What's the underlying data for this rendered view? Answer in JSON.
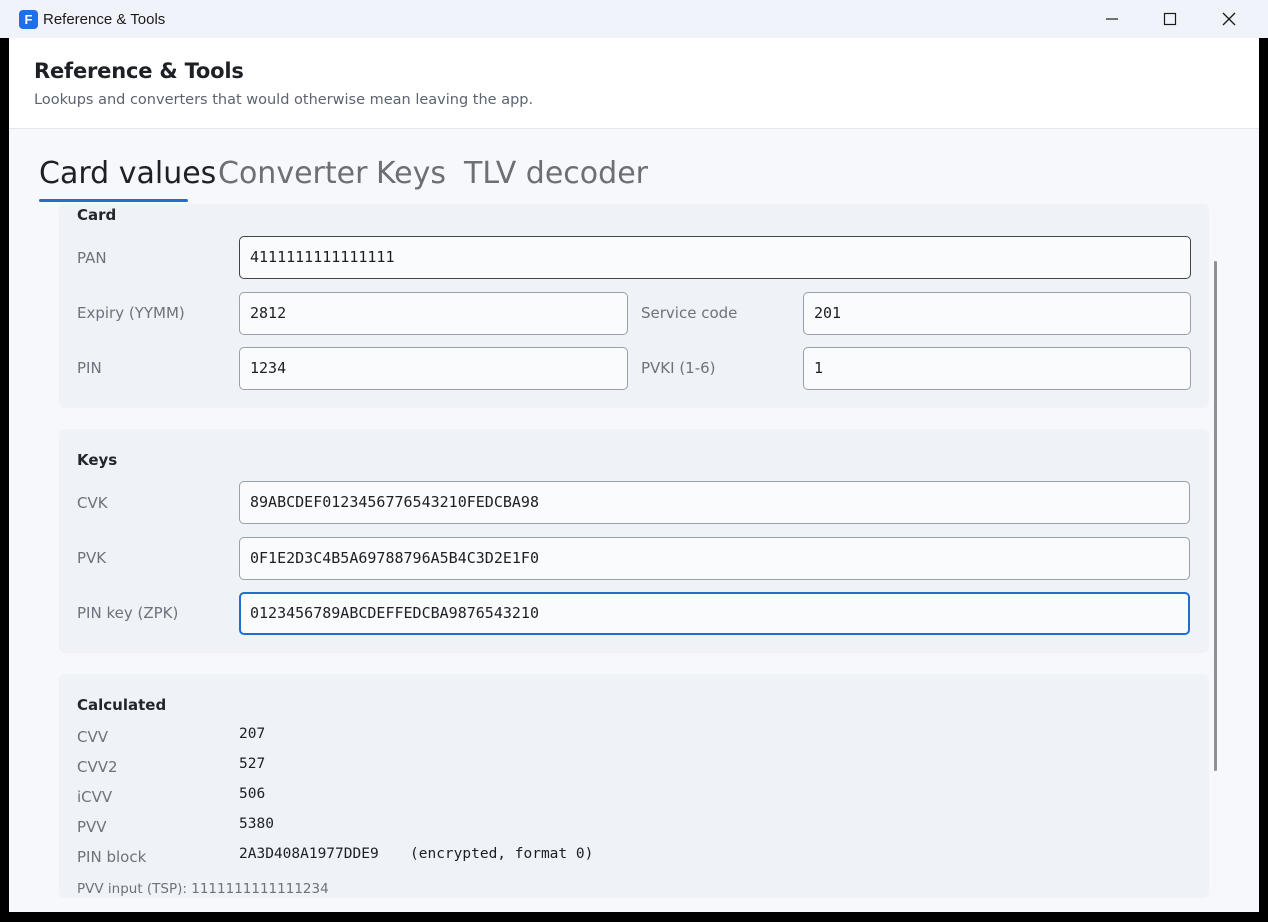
{
  "window": {
    "title": "Reference & Tools",
    "app_icon_letter": "F"
  },
  "header": {
    "title": "Reference & Tools",
    "subtitle": "Lookups and converters that would otherwise mean leaving the app."
  },
  "tabs": [
    {
      "label": "Card values",
      "active": true
    },
    {
      "label": "Converter",
      "active": false
    },
    {
      "label": "Keys",
      "active": false
    },
    {
      "label": "TLV decoder",
      "active": false
    }
  ],
  "card": {
    "title": "Card",
    "pan_label": "PAN",
    "pan_value": "4111111111111111",
    "expiry_label": "Expiry (YYMM)",
    "expiry_value": "2812",
    "service_code_label": "Service code",
    "service_code_value": "201",
    "pin_label": "PIN",
    "pin_value": "1234",
    "pvki_label": "PVKI (1-6)",
    "pvki_value": "1"
  },
  "keys": {
    "title": "Keys",
    "cvk_label": "CVK",
    "cvk_value": "89ABCDEF0123456776543210FEDCBA98",
    "pvk_label": "PVK",
    "pvk_value": "0F1E2D3C4B5A69788796A5B4C3D2E1F0",
    "zpk_label": "PIN key (ZPK)",
    "zpk_value": "0123456789ABCDEFFEDCBA9876543210"
  },
  "calculated": {
    "title": "Calculated",
    "cvv_label": "CVV",
    "cvv_value": "207",
    "cvv2_label": "CVV2",
    "cvv2_value": "527",
    "icvv_label": "iCVV",
    "icvv_value": "506",
    "pvv_label": "PVV",
    "pvv_value": "5380",
    "pin_block_label": "PIN block",
    "pin_block_value": "2A3D408A1977DDE9",
    "pin_block_note": "(encrypted, format 0)",
    "pvv_input_note": "PVV input (TSP): 1111111111111234"
  },
  "colors": {
    "accent": "#1f6fd1",
    "panel_bg": "#eff2f6",
    "content_bg": "#f6f8fb"
  }
}
